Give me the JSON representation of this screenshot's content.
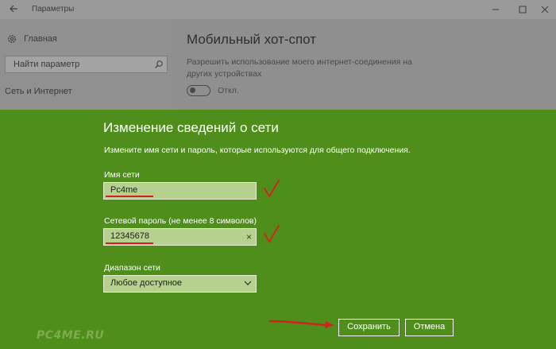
{
  "window": {
    "title": "Параметры",
    "icons": [
      "back-arrow-icon",
      "minimize-icon",
      "maximize-icon",
      "close-icon"
    ]
  },
  "sidebar": {
    "home_label": "Главная",
    "search_placeholder": "Найти параметр",
    "category": "Сеть и Интернет"
  },
  "main": {
    "heading": "Мобильный хот-спот",
    "description": "Разрешить использование моего интернет-соединения на других устройствах",
    "toggle_label": "Откл."
  },
  "dialog": {
    "title": "Изменение сведений о сети",
    "description": "Измените имя сети и пароль, которые используются для общего подключения.",
    "network_name_label": "Имя сети",
    "network_name_value": "Pc4me",
    "password_label": "Сетевой пароль (не менее 8 символов)",
    "password_value": "12345678",
    "band_label": "Диапазон сети",
    "band_value": "Любое доступное",
    "save_label": "Сохранить",
    "cancel_label": "Отмена"
  },
  "watermark": "PC4ME.RU",
  "colors": {
    "dialog_bg": "#4f8e1b",
    "field_bg": "#b6d08e",
    "annotation_red": "#d61f1f"
  }
}
